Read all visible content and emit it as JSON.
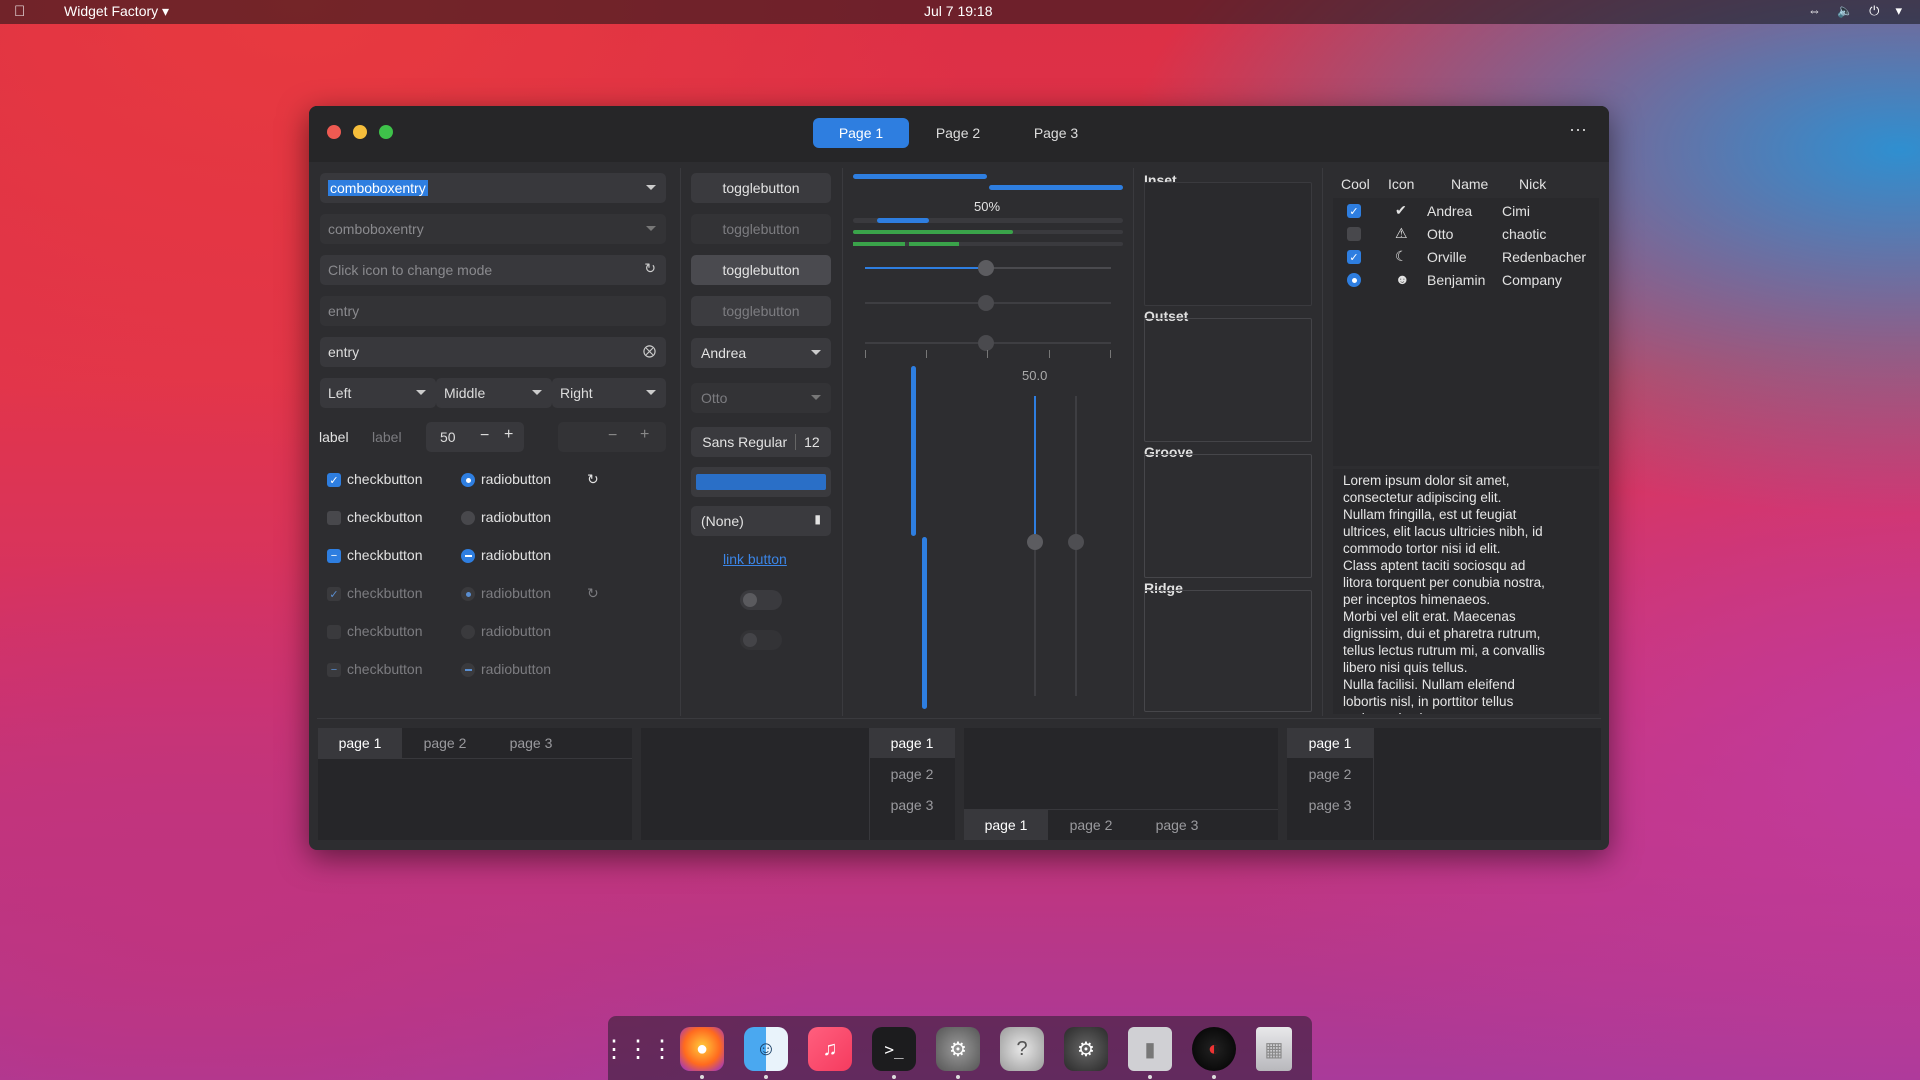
{
  "topbar": {
    "app_name": "Widget Factory ▾",
    "clock": "Jul 7  19:18",
    "icons": [
      "network-icon",
      "volume-icon",
      "power-icon",
      "chevron-down-icon"
    ]
  },
  "window": {
    "tabs": [
      "Page 1",
      "Page 2",
      "Page 3"
    ],
    "active_tab": "Page 1"
  },
  "col1": {
    "combo1": "comboboxentry",
    "combo2": "comboboxentry",
    "icon_entry_placeholder": "Click icon to change mode",
    "entry1": "entry",
    "entry2": "entry",
    "combos": [
      "Left",
      "Middle",
      "Right"
    ],
    "label1": "label",
    "label2": "label",
    "spin_value": "50",
    "checks": [
      {
        "label": "checkbutton",
        "state": "checked"
      },
      {
        "label": "checkbutton",
        "state": "unchecked"
      },
      {
        "label": "checkbutton",
        "state": "mixed"
      },
      {
        "label": "checkbutton",
        "state": "checked-disabled"
      },
      {
        "label": "checkbutton",
        "state": "unchecked-disabled"
      },
      {
        "label": "checkbutton",
        "state": "mixed-disabled"
      }
    ],
    "radios": [
      {
        "label": "radiobutton",
        "state": "checked"
      },
      {
        "label": "radiobutton",
        "state": "unchecked"
      },
      {
        "label": "radiobutton",
        "state": "mixed"
      },
      {
        "label": "radiobutton",
        "state": "checked-disabled"
      },
      {
        "label": "radiobutton",
        "state": "unchecked-disabled"
      },
      {
        "label": "radiobutton",
        "state": "mixed-disabled"
      }
    ]
  },
  "col2": {
    "toggles": [
      "togglebutton",
      "togglebutton",
      "togglebutton",
      "togglebutton"
    ],
    "combo_andrea": "Andrea",
    "combo_otto": "Otto",
    "font_name": "Sans Regular",
    "font_size": "12",
    "file_chooser": "(None)",
    "link": "link button"
  },
  "col3": {
    "progress_label": "50%",
    "scale_label": "50.0",
    "progress_fraction": 0.5
  },
  "frames": [
    "Inset",
    "Outset",
    "Groove",
    "Ridge"
  ],
  "tree": {
    "headers": [
      "Cool",
      "Icon",
      "Name",
      "Nick"
    ],
    "rows": [
      {
        "cool": "checked",
        "icon": "check-circle-icon",
        "name": "Andrea",
        "nick": "Cimi"
      },
      {
        "cool": "unchecked",
        "icon": "warning-icon",
        "name": "Otto",
        "nick": "chaotic"
      },
      {
        "cool": "checked",
        "icon": "moon-icon",
        "name": "Orville",
        "nick": "Redenbacher"
      },
      {
        "cool": "radio",
        "icon": "face-icon",
        "name": "Benjamin",
        "nick": "Company"
      }
    ]
  },
  "textview": "Lorem ipsum dolor sit amet,\nconsectetur adipiscing elit.\nNullam fringilla, est ut feugiat\nultrices, elit lacus ultricies nibh, id\ncommodo tortor nisi id elit.\nClass aptent taciti sociosqu ad\nlitora torquent per conubia nostra,\nper inceptos himenaeos.\nMorbi vel elit erat. Maecenas\ndignissim, dui et pharetra rutrum,\ntellus lectus rutrum mi, a convallis\nlibero nisi quis tellus.\nNulla facilisi. Nullam eleifend\nlobortis nisl, in porttitor tellus\nmalesuada vitae.",
  "notebooks": [
    {
      "tabs": [
        "page 1",
        "page 2",
        "page 3"
      ],
      "active": "page 1"
    },
    {
      "tabs": [
        "page 1",
        "page 2",
        "page 3"
      ],
      "active": "page 1"
    },
    {
      "tabs": [
        "page 1",
        "page 2",
        "page 3"
      ],
      "active": "page 1"
    },
    {
      "tabs": [
        "page 1",
        "page 2",
        "page 3"
      ],
      "active": "page 1"
    }
  ],
  "dock": [
    "app-grid-icon",
    "firefox-icon",
    "finder-icon",
    "music-icon",
    "terminal-icon",
    "settings-icon",
    "help-icon",
    "system-icon",
    "extensions-icon",
    "speedometer-icon",
    "trash-icon"
  ]
}
